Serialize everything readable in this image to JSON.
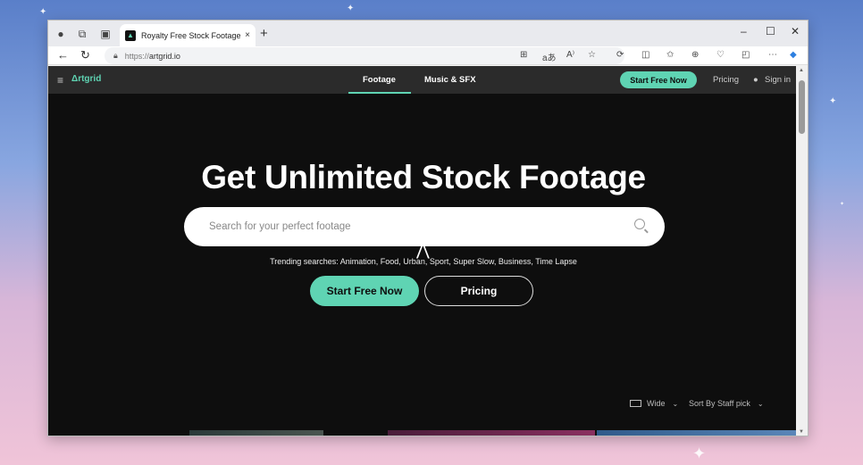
{
  "browser": {
    "tab_title": "Royalty Free Stock Footage - Artgrid",
    "tab_close": "×",
    "new_tab": "+",
    "url_protocol": "https://",
    "url_host": "artgrid.io",
    "window_controls": {
      "minimize": "–",
      "maximize": "☐",
      "close": "✕"
    }
  },
  "site_nav": {
    "logo": "Δrtgrid",
    "tabs": [
      {
        "label": "Footage",
        "active": true
      },
      {
        "label": "Music & SFX",
        "active": false
      }
    ],
    "cta": "Start Free Now",
    "pricing": "Pricing",
    "sign_in": "Sign in"
  },
  "hero": {
    "title": "Get Unlimited Stock Footage",
    "search_placeholder": "Search for your perfect footage",
    "trending": "Trending searches: Animation, Food, Urban, Sport, Super Slow, Business, Time Lapse",
    "primary_button": "Start Free Now",
    "secondary_button": "Pricing"
  },
  "view_controls": {
    "layout": "Wide",
    "sort": "Sort By Staff pick"
  },
  "colors": {
    "accent": "#5fd4b3",
    "background": "#0e0e0e",
    "nav": "#2b2b2b"
  }
}
